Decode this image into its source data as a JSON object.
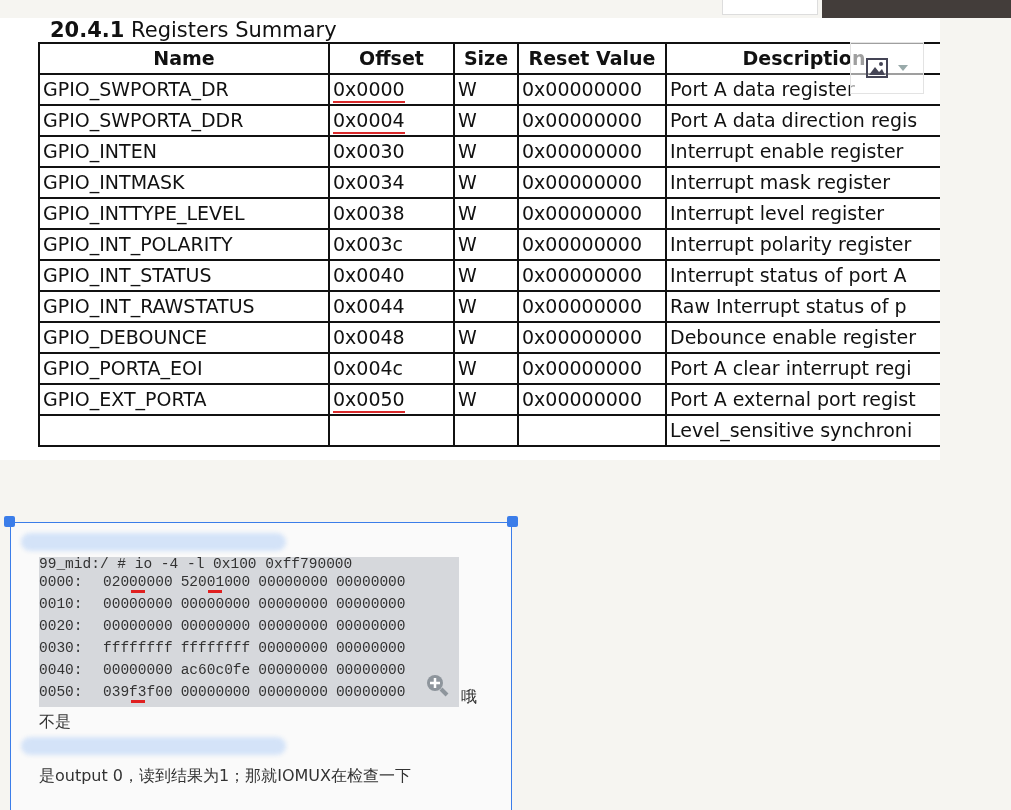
{
  "section": {
    "number": "20.4.1",
    "title": "Registers Summary"
  },
  "table": {
    "columns": [
      "Name",
      "Offset",
      "Size",
      "Reset Value",
      "Description"
    ],
    "rows": [
      {
        "cells": [
          "GPIO_SWPORTA_DR",
          "0x0000",
          "W",
          "0x00000000",
          "Port A data register"
        ],
        "underlined": true
      },
      {
        "cells": [
          "GPIO_SWPORTA_DDR",
          "0x0004",
          "W",
          "0x00000000",
          "Port A data direction regis"
        ],
        "underlined": true
      },
      {
        "cells": [
          "GPIO_INTEN",
          "0x0030",
          "W",
          "0x00000000",
          "Interrupt enable register"
        ],
        "underlined": false
      },
      {
        "cells": [
          "GPIO_INTMASK",
          "0x0034",
          "W",
          "0x00000000",
          "Interrupt mask register"
        ],
        "underlined": false
      },
      {
        "cells": [
          "GPIO_INTTYPE_LEVEL",
          "0x0038",
          "W",
          "0x00000000",
          "Interrupt level register"
        ],
        "underlined": false
      },
      {
        "cells": [
          "GPIO_INT_POLARITY",
          "0x003c",
          "W",
          "0x00000000",
          "Interrupt polarity register"
        ],
        "underlined": false
      },
      {
        "cells": [
          "GPIO_INT_STATUS",
          "0x0040",
          "W",
          "0x00000000",
          "Interrupt status of port A"
        ],
        "underlined": false
      },
      {
        "cells": [
          "GPIO_INT_RAWSTATUS",
          "0x0044",
          "W",
          "0x00000000",
          "Raw Interrupt status of p"
        ],
        "underlined": false
      },
      {
        "cells": [
          "GPIO_DEBOUNCE",
          "0x0048",
          "W",
          "0x00000000",
          "Debounce enable register"
        ],
        "underlined": false
      },
      {
        "cells": [
          "GPIO_PORTA_EOI",
          "0x004c",
          "W",
          "0x00000000",
          "Port A clear interrupt regi"
        ],
        "underlined": false
      },
      {
        "cells": [
          "GPIO_EXT_PORTA",
          "0x0050",
          "W",
          "0x00000000",
          "Port A external port regist"
        ],
        "underlined": true
      },
      {
        "cells": [
          "",
          "",
          "",
          "",
          "Level_sensitive synchroni"
        ]
      }
    ]
  },
  "terminal": {
    "command": "99_mid:/ # io -4 -l 0x100 0xff790000",
    "lines": [
      {
        "address": "0000:",
        "words": [
          {
            "text": "02000000",
            "marked": true
          },
          {
            "text": "52001000",
            "marked": true
          },
          {
            "text": "00000000",
            "marked": false
          },
          {
            "text": "00000000",
            "marked": false
          }
        ]
      },
      {
        "address": "0010:",
        "words": [
          {
            "text": "00000000",
            "marked": false
          },
          {
            "text": "00000000",
            "marked": false
          },
          {
            "text": "00000000",
            "marked": false
          },
          {
            "text": "00000000",
            "marked": false
          }
        ]
      },
      {
        "address": "0020:",
        "words": [
          {
            "text": "00000000",
            "marked": false
          },
          {
            "text": "00000000",
            "marked": false
          },
          {
            "text": "00000000",
            "marked": false
          },
          {
            "text": "00000000",
            "marked": false
          }
        ]
      },
      {
        "address": "0030:",
        "words": [
          {
            "text": "ffffffff",
            "marked": false
          },
          {
            "text": "ffffffff",
            "marked": false
          },
          {
            "text": "00000000",
            "marked": false
          },
          {
            "text": "00000000",
            "marked": false
          }
        ]
      },
      {
        "address": "0040:",
        "words": [
          {
            "text": "00000000",
            "marked": false
          },
          {
            "text": "ac60c0fe",
            "marked": false
          },
          {
            "text": "00000000",
            "marked": false
          },
          {
            "text": "00000000",
            "marked": false
          }
        ]
      },
      {
        "address": "0050:",
        "words": [
          {
            "text": "039f3f00",
            "marked": true
          },
          {
            "text": "00000000",
            "marked": false
          },
          {
            "text": "00000000",
            "marked": false
          },
          {
            "text": "00000000",
            "marked": false
          }
        ]
      }
    ]
  },
  "chat": [
    {
      "kind": "blurred"
    },
    {
      "kind": "aside",
      "text": "哦"
    },
    {
      "kind": "text",
      "text": "不是"
    },
    {
      "kind": "blurred"
    },
    {
      "kind": "text",
      "text": "是output 0，读到结果为1；那就IOMUX在检查一下"
    }
  ]
}
